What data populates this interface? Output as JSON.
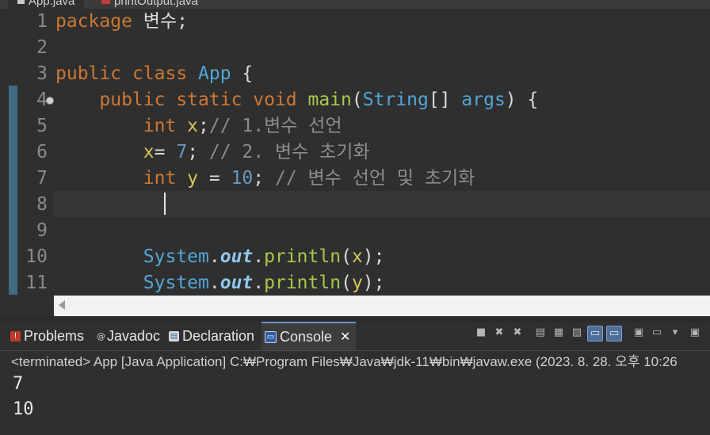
{
  "editor_tabs": [
    {
      "label": "App.java",
      "active": true
    },
    {
      "label": "printOutput.java",
      "active": false
    }
  ],
  "editor": {
    "line_numbers": [
      "1",
      "2",
      "3",
      "4",
      "5",
      "6",
      "7",
      "8",
      "9",
      "10",
      "11"
    ],
    "lines": [
      [
        {
          "t": "package ",
          "c": "kw"
        },
        {
          "t": "변수;",
          "c": "pl"
        }
      ],
      [],
      [
        {
          "t": "public ",
          "c": "kw"
        },
        {
          "t": "class ",
          "c": "kw"
        },
        {
          "t": "App ",
          "c": "tp"
        },
        {
          "t": "{",
          "c": "pl"
        }
      ],
      [
        {
          "t": "    public ",
          "c": "kw"
        },
        {
          "t": "static ",
          "c": "kw"
        },
        {
          "t": "void ",
          "c": "kw"
        },
        {
          "t": "main",
          "c": "fn"
        },
        {
          "t": "(",
          "c": "pl"
        },
        {
          "t": "String",
          "c": "tp"
        },
        {
          "t": "[] ",
          "c": "pl"
        },
        {
          "t": "args",
          "c": "tp"
        },
        {
          "t": ") {",
          "c": "pl"
        }
      ],
      [
        {
          "t": "        int ",
          "c": "kw"
        },
        {
          "t": "x",
          "c": "vr"
        },
        {
          "t": ";",
          "c": "pl"
        },
        {
          "t": "// 1.변수 선언",
          "c": "cm"
        }
      ],
      [
        {
          "t": "        x",
          "c": "vr"
        },
        {
          "t": "= ",
          "c": "pl"
        },
        {
          "t": "7",
          "c": "nm"
        },
        {
          "t": "; ",
          "c": "pl"
        },
        {
          "t": "// 2. 변수 초기화",
          "c": "cm"
        }
      ],
      [
        {
          "t": "        int ",
          "c": "kw"
        },
        {
          "t": "y",
          "c": "vr"
        },
        {
          "t": " = ",
          "c": "pl"
        },
        {
          "t": "10",
          "c": "nm"
        },
        {
          "t": "; ",
          "c": "pl"
        },
        {
          "t": "// 변수 선언 및 초기화",
          "c": "cm"
        }
      ],
      [],
      [],
      [
        {
          "t": "        System",
          "c": "tp"
        },
        {
          "t": ".",
          "c": "pl"
        },
        {
          "t": "out",
          "c": "fd"
        },
        {
          "t": ".",
          "c": "pl"
        },
        {
          "t": "println",
          "c": "fn"
        },
        {
          "t": "(",
          "c": "pl"
        },
        {
          "t": "x",
          "c": "vr"
        },
        {
          "t": ");",
          "c": "pl"
        }
      ],
      [
        {
          "t": "        System",
          "c": "tp"
        },
        {
          "t": ".",
          "c": "pl"
        },
        {
          "t": "out",
          "c": "fd"
        },
        {
          "t": ".",
          "c": "pl"
        },
        {
          "t": "println",
          "c": "fn"
        },
        {
          "t": "(",
          "c": "pl"
        },
        {
          "t": "y",
          "c": "vr"
        },
        {
          "t": ");",
          "c": "pl"
        }
      ]
    ]
  },
  "views": {
    "tabs": [
      {
        "label": "Problems",
        "icon": "problems-icon"
      },
      {
        "label": "Javadoc",
        "icon": "javadoc-icon"
      },
      {
        "label": "Declaration",
        "icon": "declaration-icon"
      },
      {
        "label": "Console",
        "icon": "console-icon",
        "active": true
      }
    ],
    "close_glyph": "✕"
  },
  "console": {
    "header": "<terminated> App [Java Application] C:₩Program Files₩Java₩jdk-11₩bin₩javaw.exe  (2023. 8. 28. 오후 10:26",
    "output": [
      "7",
      "10"
    ]
  }
}
